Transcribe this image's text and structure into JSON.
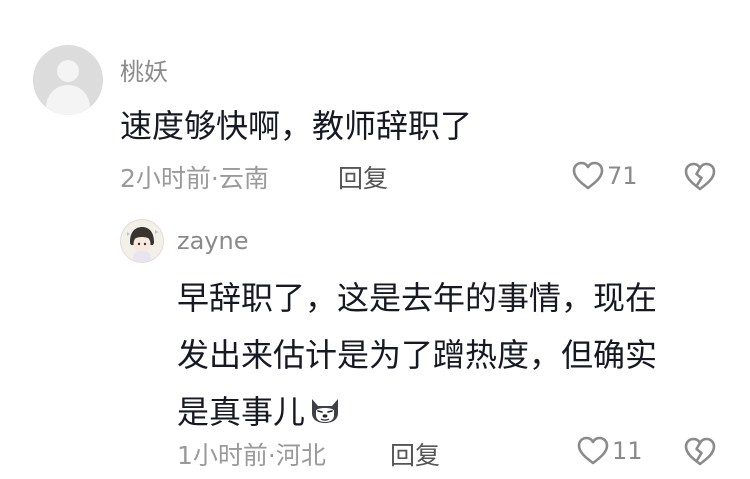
{
  "comments": [
    {
      "username": "桃妖",
      "text": "速度够快啊，教师辞职了",
      "meta": "2小时前·云南",
      "reply_label": "回复",
      "likes": "71"
    },
    {
      "username": "zayne",
      "text_lines": [
        "早辞职了，这是去年的事情，现在",
        "发出来估计是为了蹭热度，但确实",
        "是真事儿"
      ],
      "meta": "1小时前·河北",
      "reply_label": "回复",
      "likes": "11"
    }
  ],
  "icons": {
    "like": "heart-outline-icon",
    "dislike": "broken-heart-icon",
    "emoji": "cat-face-emoji"
  }
}
